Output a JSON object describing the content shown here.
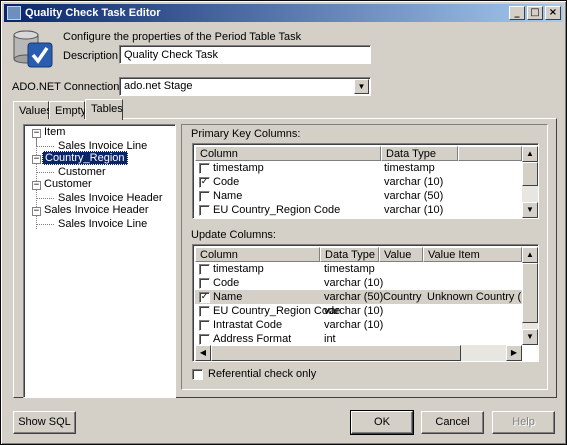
{
  "window": {
    "title": "Quality Check Task Editor"
  },
  "titlebar_buttons": {
    "minimize": "_",
    "maximize": "□",
    "close": "×"
  },
  "header": {
    "configure_text": "Configure the properties of the Period Table Task",
    "description_label": "Description:",
    "description_value": "Quality Check Task",
    "connection_label": "ADO.NET Connection:",
    "connection_value": "ado.net Stage"
  },
  "tabs": [
    {
      "label": "Values",
      "active": false
    },
    {
      "label": "Empty",
      "active": false
    },
    {
      "label": "Tables",
      "active": true
    }
  ],
  "tree": {
    "nodes": [
      {
        "label": "Item",
        "level": 0,
        "toggle": "−"
      },
      {
        "label": "Sales Invoice Line",
        "level": 1
      },
      {
        "label": "Country_Region",
        "level": 0,
        "toggle": "−",
        "selected": true
      },
      {
        "label": "Customer",
        "level": 1
      },
      {
        "label": "Customer",
        "level": 0,
        "toggle": "−"
      },
      {
        "label": "Sales Invoice Header",
        "level": 1
      },
      {
        "label": "Sales Invoice Header",
        "level": 0,
        "toggle": "−"
      },
      {
        "label": "Sales Invoice Line",
        "level": 1
      }
    ]
  },
  "primary_key": {
    "label": "Primary Key Columns:",
    "headers": [
      "Column",
      "Data Type"
    ],
    "rows": [
      {
        "checked": false,
        "column": "timestamp",
        "type": "timestamp"
      },
      {
        "checked": true,
        "column": "Code",
        "type": "varchar (10)"
      },
      {
        "checked": false,
        "column": "Name",
        "type": "varchar (50)"
      },
      {
        "checked": false,
        "column": "EU Country_Region Code",
        "type": "varchar (10)"
      }
    ]
  },
  "update_columns": {
    "label": "Update Columns:",
    "headers": [
      "Column",
      "Data Type",
      "Value",
      "Value Item"
    ],
    "rows": [
      {
        "checked": false,
        "column": "timestamp",
        "type": "timestamp",
        "value": "",
        "value_item": ""
      },
      {
        "checked": false,
        "column": "Code",
        "type": "varchar (10)",
        "value": "",
        "value_item": ""
      },
      {
        "checked": true,
        "column": "Name",
        "type": "varchar (50)",
        "value": "Country",
        "value_item": "Unknown Country (Long"
      },
      {
        "checked": false,
        "column": "EU Country_Region Code",
        "type": "varchar (10)",
        "value": "",
        "value_item": ""
      },
      {
        "checked": false,
        "column": "Intrastat Code",
        "type": "varchar (10)",
        "value": "",
        "value_item": ""
      },
      {
        "checked": false,
        "column": "Address Format",
        "type": "int",
        "value": "",
        "value_item": ""
      }
    ]
  },
  "referential_check": {
    "label": "Referential check only",
    "checked": false
  },
  "buttons": {
    "show_sql": "Show SQL",
    "ok": "OK",
    "cancel": "Cancel",
    "help": "Help"
  },
  "colors": {
    "selection": "#0a246a",
    "titlebar_start": "#0a246a",
    "titlebar_end": "#a6caf0",
    "face": "#d4d0c8"
  }
}
